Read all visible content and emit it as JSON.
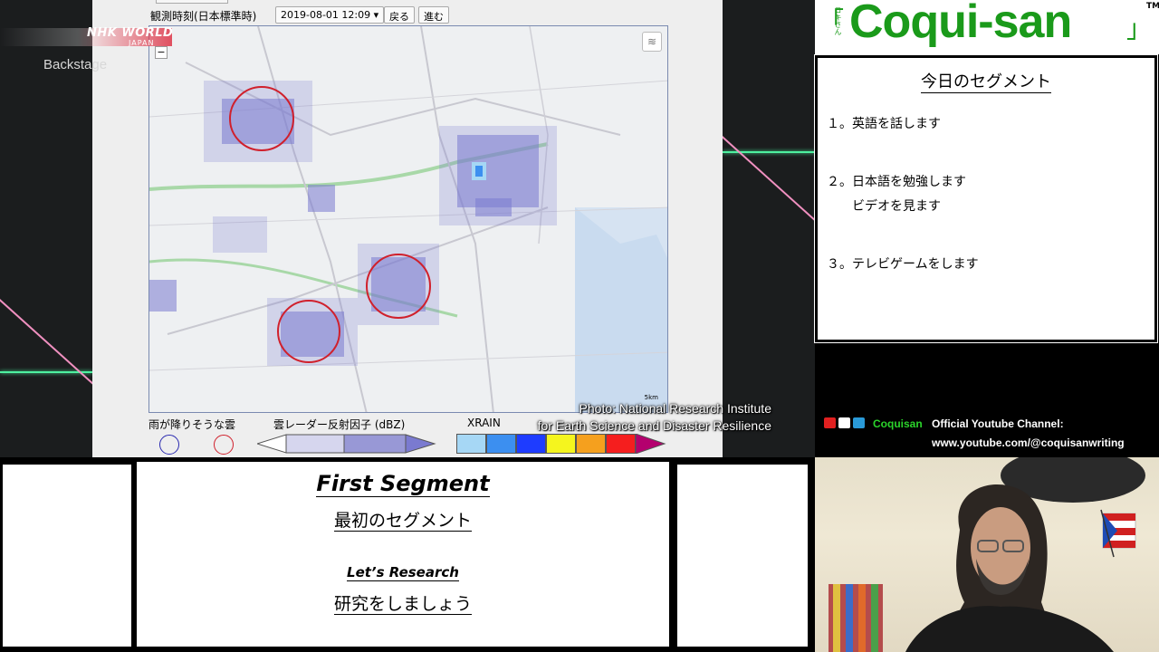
{
  "video": {
    "network_logo_line1": "NHK WORLD",
    "network_logo_line2": "JAPAN",
    "show_title": "Backstage",
    "observation_label": "観測時刻(日本標準時)",
    "observation_time": "2019-08-01 12:09",
    "back_button": "戻る",
    "forward_button": "進む",
    "zoom_out": "−",
    "scale_label": "5km",
    "legend": {
      "clouds_label": "雨が降りそうな雲",
      "radar_label": "雲レーダー反射因子 (dBZ)",
      "xrain_label": "XRAIN"
    },
    "photo_credit_line1": "Photo: National Research Institute",
    "photo_credit_line2": "for Earth Science and Disaster Resilience",
    "colors": {
      "echo_purple": "#7a7ad0",
      "circle_red": "#d0202c",
      "xrain": [
        "#a6d7f5",
        "#3c8ff0",
        "#1e3cff",
        "#f5f51e",
        "#f5a01e",
        "#f51e1e",
        "#b4006e"
      ]
    }
  },
  "brand": {
    "logo_text": "Coqui-san",
    "logo_kana": "コキさん",
    "left_bracket": "「",
    "right_bracket": "」",
    "trademark": "TM",
    "brand_color": "#1a9a1a"
  },
  "segments": {
    "title": "今日のセグメント",
    "items": [
      "１。英語を話します",
      "２。日本語を勉強します",
      "ビデオを見ます",
      "３。テレビゲームをします"
    ]
  },
  "channel": {
    "name": "Coquisan",
    "label": "Official Youtube Channel:",
    "url": "www.youtube.com/@coquisanwriting",
    "icons": [
      "video-icon",
      "trophy-icon",
      "crown-icon"
    ]
  },
  "main": {
    "title": "First Segment",
    "subtitle": "最初のセグメント",
    "research_title": "Let’s Research",
    "research_subtitle": "研究をしましょう"
  }
}
